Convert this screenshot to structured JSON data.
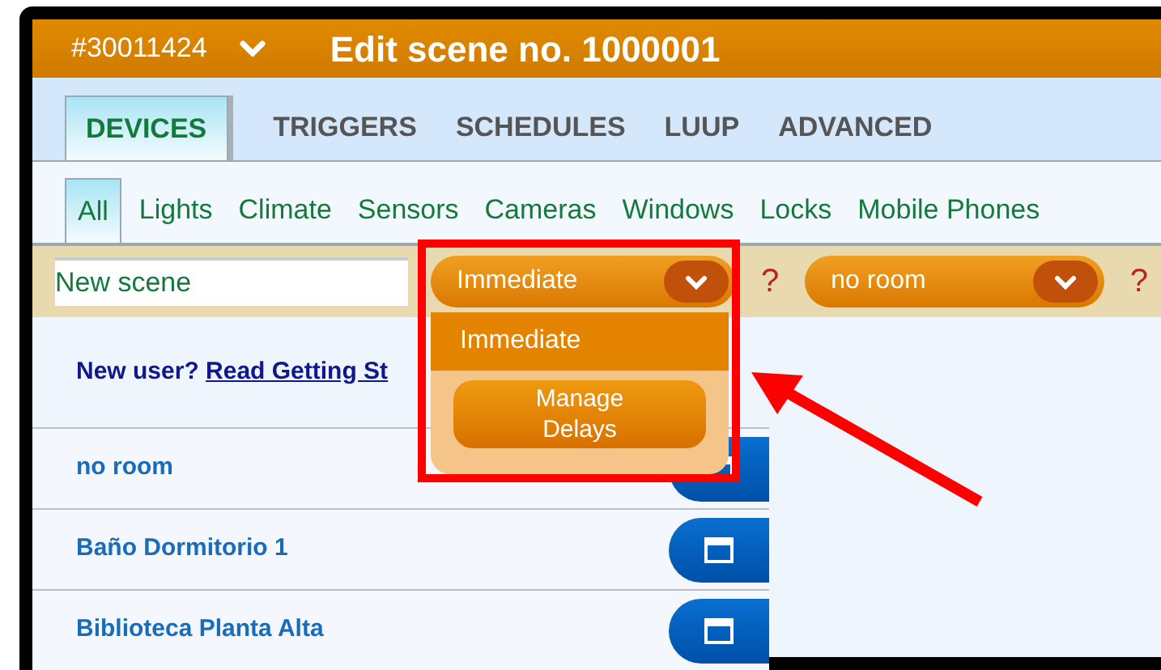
{
  "header": {
    "device_id": "#30011424",
    "title": "Edit scene no. 1000001"
  },
  "tabs": [
    {
      "label": "DEVICES",
      "selected": true
    },
    {
      "label": "TRIGGERS",
      "selected": false
    },
    {
      "label": "SCHEDULES",
      "selected": false
    },
    {
      "label": "LUUP",
      "selected": false
    },
    {
      "label": "ADVANCED",
      "selected": false
    }
  ],
  "categories": [
    {
      "label": "All",
      "selected": true
    },
    {
      "label": "Lights",
      "selected": false
    },
    {
      "label": "Climate",
      "selected": false
    },
    {
      "label": "Sensors",
      "selected": false
    },
    {
      "label": "Cameras",
      "selected": false
    },
    {
      "label": "Windows",
      "selected": false
    },
    {
      "label": "Locks",
      "selected": false
    },
    {
      "label": "Mobile Phones",
      "selected": false
    }
  ],
  "scene_name": {
    "value": "New scene"
  },
  "delay_select": {
    "value": "Immediate",
    "help": "?",
    "expanded": true,
    "options": [
      {
        "label": "Immediate"
      }
    ],
    "manage_button": "Manage Delays"
  },
  "room_select": {
    "value": "no room",
    "help": "?"
  },
  "notice": {
    "prefix": "New user?",
    "link": "Read Getting St"
  },
  "rooms": [
    {
      "name": "no room"
    },
    {
      "name": "Baño Dormitorio 1"
    },
    {
      "name": "Biblioteca Planta Alta"
    }
  ]
}
